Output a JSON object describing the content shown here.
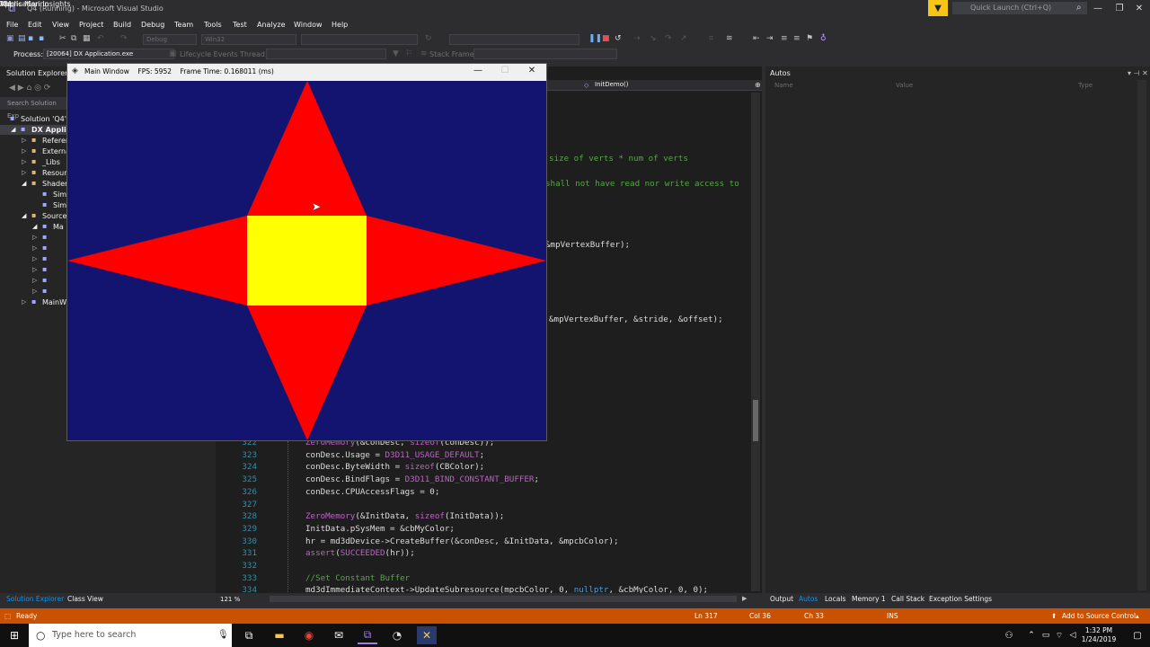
{
  "titlebar": {
    "title": "Q4 (Running) - Microsoft Visual Studio",
    "quick_launch": "Quick Launch (Ctrl+Q)"
  },
  "menu": [
    "File",
    "Edit",
    "View",
    "Project",
    "Build",
    "Debug",
    "Team",
    "Tools",
    "Test",
    "Analyze",
    "Window",
    "Help"
  ],
  "user": {
    "name": "Morris Marino",
    "initials": "VM"
  },
  "toolbar": {
    "config": "Debug",
    "platform": "Win32",
    "app_insights": "Application Insights"
  },
  "process_bar": {
    "process_label": "Process:",
    "process_value": "[20064] DX Application.exe",
    "lifecycle": "Lifecycle Events",
    "thread": "Thread:",
    "stack_frame": "Stack Frame:"
  },
  "solution_explorer": {
    "title": "Solution Explorer",
    "search_placeholder": "Search Solution Exp",
    "items": [
      {
        "label": "Solution 'Q4'",
        "level": 0
      },
      {
        "label": "DX Applic",
        "level": 1,
        "bold": true
      },
      {
        "label": "Referen",
        "level": 2
      },
      {
        "label": "Externa",
        "level": 2
      },
      {
        "label": "_Libs",
        "level": 2
      },
      {
        "label": "Resour",
        "level": 2
      },
      {
        "label": "Shader",
        "level": 2
      },
      {
        "label": "Sim",
        "level": 3
      },
      {
        "label": "Sim",
        "level": 3
      },
      {
        "label": "Source",
        "level": 2
      },
      {
        "label": "Ma",
        "level": 3
      },
      {
        "label": "",
        "level": 4
      },
      {
        "label": "",
        "level": 4
      },
      {
        "label": "",
        "level": 4
      },
      {
        "label": "",
        "level": 4
      },
      {
        "label": "",
        "level": 4
      },
      {
        "label": "",
        "level": 4
      },
      {
        "label": "MainW",
        "level": 2
      }
    ]
  },
  "editor": {
    "nav_function": "InitDemo()",
    "partial_lines": [
      {
        "text": "size of verts * num of verts",
        "cls": "c-cmt"
      },
      {
        "text": "shall not have read nor write access to",
        "cls": "c-cmt"
      },
      {
        "text": "&mpVertexBuffer);",
        "cls": "c-def"
      },
      {
        "text": "&mpVertexBuffer, &stride, &offset);",
        "cls": "c-def"
      }
    ],
    "lines": [
      {
        "num": "322",
        "tokens": [
          {
            "t": "ZeroMemory",
            "c": "c-mac"
          },
          {
            "t": "(&conDesc, ",
            "c": "c-def"
          },
          {
            "t": "sizeof",
            "c": "c-mac"
          },
          {
            "t": "(conDesc));",
            "c": "c-def"
          }
        ]
      },
      {
        "num": "323",
        "tokens": [
          {
            "t": "conDesc.Usage = ",
            "c": "c-def"
          },
          {
            "t": "D3D11_USAGE_DEFAULT",
            "c": "c-mac"
          },
          {
            "t": ";",
            "c": "c-def"
          }
        ]
      },
      {
        "num": "324",
        "tokens": [
          {
            "t": "conDesc.ByteWidth = ",
            "c": "c-def"
          },
          {
            "t": "sizeof",
            "c": "c-mac"
          },
          {
            "t": "(CBColor);",
            "c": "c-def"
          }
        ]
      },
      {
        "num": "325",
        "tokens": [
          {
            "t": "conDesc.BindFlags = ",
            "c": "c-def"
          },
          {
            "t": "D3D11_BIND_CONSTANT_BUFFER",
            "c": "c-mac"
          },
          {
            "t": ";",
            "c": "c-def"
          }
        ]
      },
      {
        "num": "326",
        "tokens": [
          {
            "t": "conDesc.CPUAccessFlags = 0;",
            "c": "c-def"
          }
        ]
      },
      {
        "num": "327",
        "tokens": []
      },
      {
        "num": "328",
        "tokens": [
          {
            "t": "ZeroMemory",
            "c": "c-mac"
          },
          {
            "t": "(&InitData, ",
            "c": "c-def"
          },
          {
            "t": "sizeof",
            "c": "c-mac"
          },
          {
            "t": "(InitData));",
            "c": "c-def"
          }
        ]
      },
      {
        "num": "329",
        "tokens": [
          {
            "t": "InitData.pSysMem = &cbMyColor;",
            "c": "c-def"
          }
        ]
      },
      {
        "num": "330",
        "tokens": [
          {
            "t": "hr = md3dDevice->CreateBuffer(&conDesc, &InitData, &mpcbColor);",
            "c": "c-def"
          }
        ]
      },
      {
        "num": "331",
        "tokens": [
          {
            "t": "assert",
            "c": "c-mac"
          },
          {
            "t": "(",
            "c": "c-def"
          },
          {
            "t": "SUCCEEDED",
            "c": "c-mac"
          },
          {
            "t": "(hr));",
            "c": "c-def"
          }
        ]
      },
      {
        "num": "332",
        "tokens": []
      },
      {
        "num": "333",
        "tokens": [
          {
            "t": "//Set Constant Buffer",
            "c": "c-cmt"
          }
        ]
      },
      {
        "num": "334",
        "tokens": [
          {
            "t": "md3dImmediateContext->UpdateSubresource(mpcbColor, 0, ",
            "c": "c-def"
          },
          {
            "t": "nullptr",
            "c": "c-kw"
          },
          {
            "t": ", &cbMyColor, 0, 0);",
            "c": "c-def"
          }
        ]
      }
    ],
    "zoom": "121 %"
  },
  "autos": {
    "title": "Autos",
    "columns": [
      "Name",
      "Value",
      "Type"
    ]
  },
  "bottom_tabs_left": [
    "Solution Explorer",
    "Class View"
  ],
  "bottom_tabs_right": [
    "Output",
    "Autos",
    "Locals",
    "Memory 1",
    "Call Stack",
    "Exception Settings"
  ],
  "statusbar": {
    "state": "Ready",
    "ln": "Ln 317",
    "col": "Col 36",
    "ch": "Ch 33",
    "ins": "INS",
    "source_control": "Add to Source Control"
  },
  "taskbar": {
    "search_placeholder": "Type here to search",
    "time": "1:32 PM",
    "date": "1/24/2019"
  },
  "app_window": {
    "title": "Main Window    FPS: 5952    Frame Time: 0.168011 (ms)",
    "bg_color": "#131470",
    "star_color": "#ff0000",
    "square_color": "#ffff00"
  },
  "colors": {
    "accent_orange": "#ca5100",
    "editor_bg": "#1e1e1e",
    "ide_bg": "#2d2d30"
  }
}
